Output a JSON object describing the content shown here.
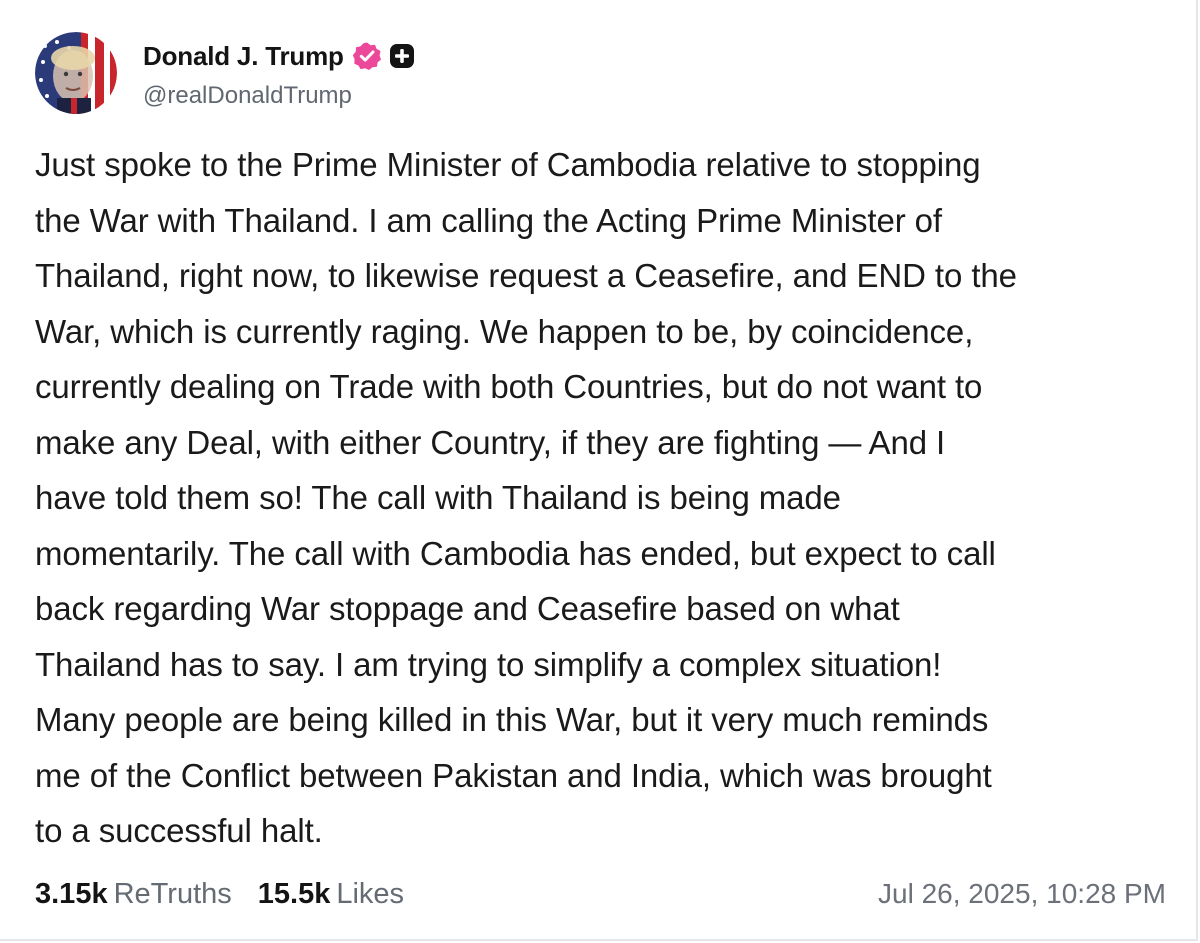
{
  "author": {
    "display_name": "Donald J. Trump",
    "handle": "@realDonaldTrump",
    "verified_badge_icon": "verified-badge-icon",
    "plus_badge_icon": "plus-badge-icon",
    "colors": {
      "verified": "#ec4899",
      "plus_badge": "#141414"
    }
  },
  "post": {
    "text": "Just spoke to the Prime Minister of Cambodia relative to stopping\nthe War with Thailand. I am calling the Acting Prime Minister of\nThailand, right now, to likewise request a Ceasefire, and END to the\nWar, which is currently raging. We happen to be, by coincidence,\ncurrently dealing on Trade with both Countries, but do not want to\nmake any Deal, with either Country, if they are fighting — And I\nhave told them so! The call with Thailand is being made\nmomentarily. The call with Cambodia has ended, but expect to call\nback regarding War stoppage and Ceasefire based on what\nThailand has to say. I am trying to simplify a complex situation!\nMany people are being killed in this War, but it very much reminds\nme of the Conflict between Pakistan and India, which was brought\nto a successful halt."
  },
  "stats": {
    "retruths_count": "3.15k",
    "retruths_label": "ReTruths",
    "likes_count": "15.5k",
    "likes_label": "Likes"
  },
  "timestamp": "Jul 26, 2025, 10:28 PM"
}
